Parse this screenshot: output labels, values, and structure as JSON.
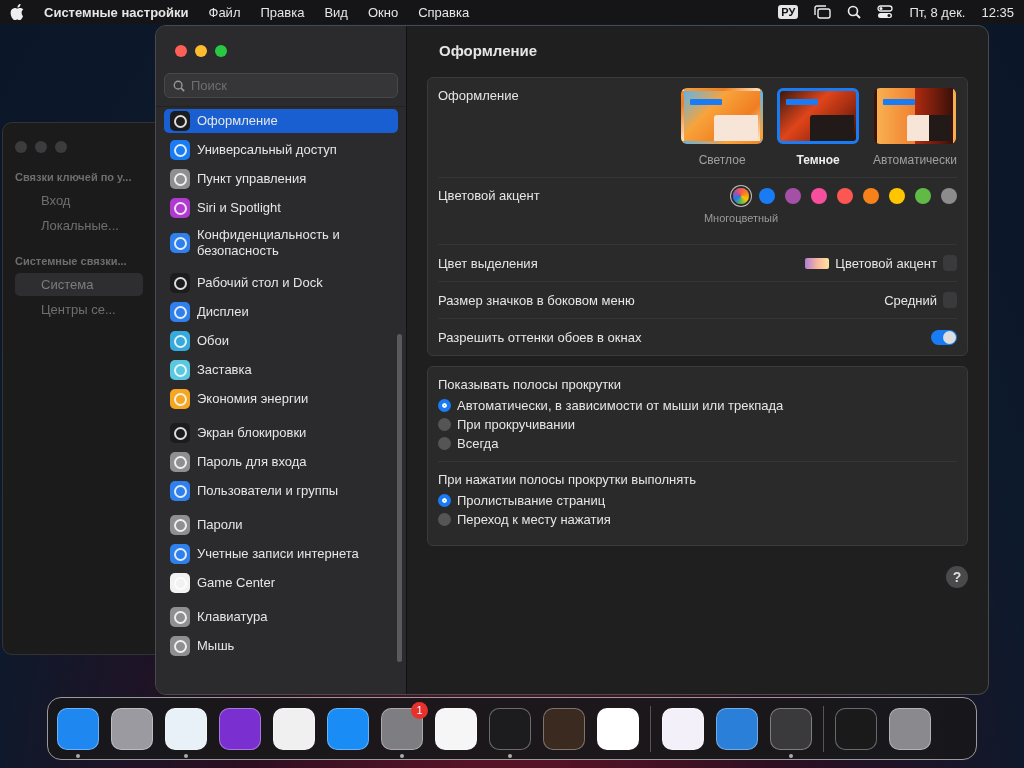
{
  "menubar": {
    "app_name": "Системные настройки",
    "menus": [
      "Файл",
      "Правка",
      "Вид",
      "Окно",
      "Справка"
    ],
    "input_source": "РУ",
    "date": "Пт, 8 дек.",
    "time": "12:35"
  },
  "background_window": {
    "sections": [
      {
        "header": "Связки ключей по у...",
        "items": [
          {
            "label": "Вход",
            "selected": false
          },
          {
            "label": "Локальные...",
            "selected": false
          }
        ]
      },
      {
        "header": "Системные связки...",
        "items": [
          {
            "label": "Система",
            "selected": true
          },
          {
            "label": "Центры се...",
            "selected": false
          }
        ]
      }
    ]
  },
  "sidebar": {
    "search": {
      "placeholder": "Поиск"
    },
    "sections": [
      {
        "items": [
          {
            "label": "Оформление",
            "selected": true,
            "color": "#1c1c1e"
          },
          {
            "label": "Универсальный доступ",
            "selected": false,
            "color": "#1a7cf5"
          },
          {
            "label": "Пункт управления",
            "selected": false,
            "color": "#8e8e93"
          },
          {
            "label": "Siri и Spotlight",
            "selected": false,
            "color": "#b03ad0"
          },
          {
            "label": "Конфиденциальность и безопасность",
            "selected": false,
            "color": "#2f80ed"
          }
        ]
      },
      {
        "items": [
          {
            "label": "Рабочий стол и Dock",
            "selected": false,
            "color": "#1c1c1e"
          },
          {
            "label": "Дисплеи",
            "selected": false,
            "color": "#2f80ed"
          },
          {
            "label": "Обои",
            "selected": false,
            "color": "#36aadc"
          },
          {
            "label": "Заставка",
            "selected": false,
            "color": "#5ac8e0"
          },
          {
            "label": "Экономия энергии",
            "selected": false,
            "color": "#f5a623"
          }
        ]
      },
      {
        "items": [
          {
            "label": "Экран блокировки",
            "selected": false,
            "color": "#1c1c1e"
          },
          {
            "label": "Пароль для входа",
            "selected": false,
            "color": "#8e8e93"
          },
          {
            "label": "Пользователи и группы",
            "selected": false,
            "color": "#2f80ed"
          }
        ]
      },
      {
        "items": [
          {
            "label": "Пароли",
            "selected": false,
            "color": "#8e8e93"
          },
          {
            "label": "Учетные записи интернета",
            "selected": false,
            "color": "#2f80ed"
          },
          {
            "label": "Game Center",
            "selected": false,
            "color": "#f2f2f2"
          }
        ]
      },
      {
        "items": [
          {
            "label": "Клавиатура",
            "selected": false,
            "color": "#8e8e93"
          },
          {
            "label": "Мышь",
            "selected": false,
            "color": "#8e8e93"
          }
        ]
      }
    ]
  },
  "content": {
    "title": "Оформление",
    "appearance": {
      "label": "Оформление",
      "options": [
        {
          "kind": "light",
          "label": "Светлое",
          "selected": false
        },
        {
          "kind": "dark",
          "label": "Темное",
          "selected": true
        },
        {
          "kind": "auto",
          "label": "Автоматически",
          "selected": false
        }
      ]
    },
    "accent": {
      "label": "Цветовой акцент",
      "colors": [
        {
          "kind": "multicolor",
          "label": "Многоцветный",
          "selected": true
        },
        {
          "kind": "solid",
          "color": "#1a7cf5",
          "selected": false
        },
        {
          "kind": "solid",
          "color": "#a550a7",
          "selected": false
        },
        {
          "kind": "solid",
          "color": "#f74f9e",
          "selected": false
        },
        {
          "kind": "solid",
          "color": "#fc5753",
          "selected": false
        },
        {
          "kind": "solid",
          "color": "#f7821b",
          "selected": false
        },
        {
          "kind": "solid",
          "color": "#ffc600",
          "selected": false
        },
        {
          "kind": "solid",
          "color": "#62ba46",
          "selected": false
        },
        {
          "kind": "solid",
          "color": "#8c8c8c",
          "selected": false
        }
      ]
    },
    "highlight": {
      "label": "Цвет выделения",
      "value": "Цветовой акцент"
    },
    "icon_size": {
      "label": "Размер значков в боковом меню",
      "value": "Средний"
    },
    "wallpaper_tint": {
      "label": "Разрешить оттенки обоев в окнах",
      "on": true
    },
    "scroll_groups": [
      {
        "title": "Показывать полосы прокрутки",
        "options": [
          {
            "label": "Автоматически, в зависимости от мыши или трекпада",
            "selected": true
          },
          {
            "label": "При прокручивании",
            "selected": false
          },
          {
            "label": "Всегда",
            "selected": false
          }
        ]
      },
      {
        "title": "При нажатии полосы прокрутки выполнять",
        "options": [
          {
            "label": "Пролистывание страниц",
            "selected": true
          },
          {
            "label": "Переход к месту нажатия",
            "selected": false
          }
        ]
      }
    ],
    "help": "?"
  },
  "dock": {
    "sections": [
      {
        "apps": [
          {
            "color": "#1e88f0",
            "running": true
          },
          {
            "color": "#9a9aa0",
            "running": false
          },
          {
            "color": "#e8f0f8",
            "running": true
          },
          {
            "color": "#7a2fd0",
            "running": false
          },
          {
            "color": "#f0f0f0",
            "running": false
          },
          {
            "color": "#1a8cf5",
            "running": false
          },
          {
            "color": "#7d7d82",
            "running": true,
            "badge": "1"
          },
          {
            "color": "#f6f6f6",
            "running": false
          },
          {
            "color": "#1c1c1e",
            "running": true
          },
          {
            "color": "#3a2a20",
            "running": false
          },
          {
            "color": "#ffffff",
            "running": false
          }
        ]
      },
      {
        "apps": [
          {
            "color": "#f4f0fa",
            "running": false
          },
          {
            "color": "#2a7fd8",
            "running": false
          },
          {
            "color": "#3a3a3c",
            "running": true
          }
        ]
      },
      {
        "apps": [
          {
            "color": "#1a1a1a",
            "running": false
          },
          {
            "color": "#8a8a8e",
            "running": false
          }
        ]
      }
    ]
  }
}
